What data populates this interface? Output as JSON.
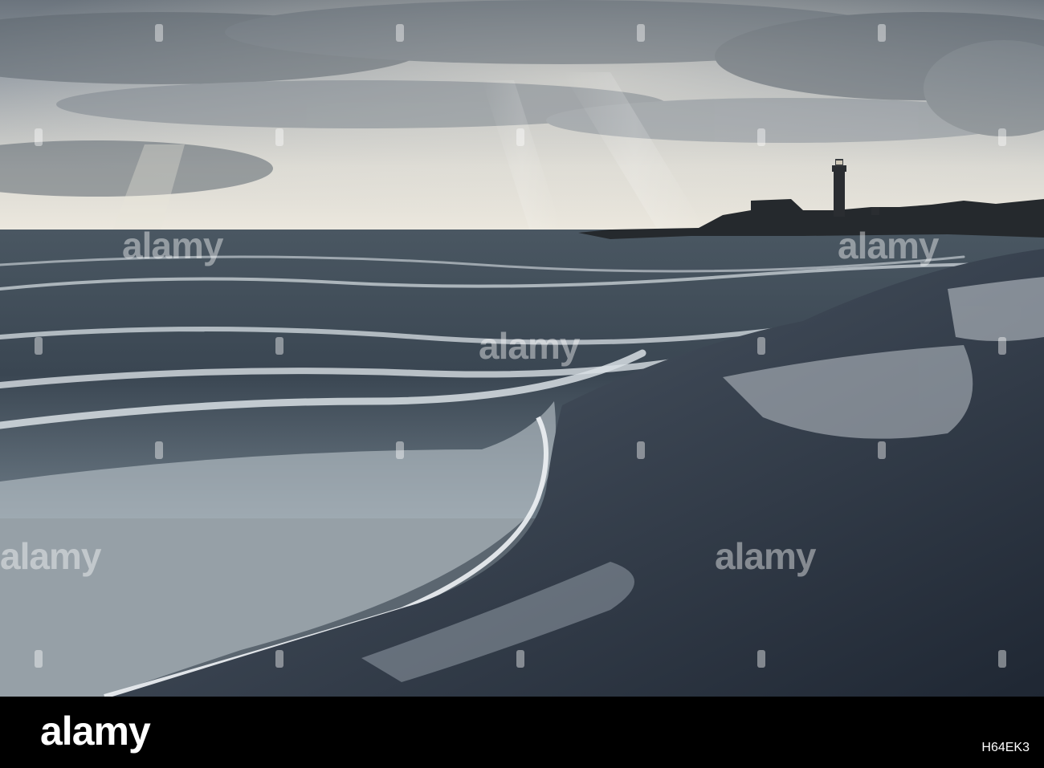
{
  "watermark": {
    "brand_text": "alamy"
  },
  "footer": {
    "logo_text": "alamy",
    "image_id_label": "",
    "image_id": "H64EK3",
    "background_color": "#000000",
    "text_color": "#ffffff"
  },
  "photo": {
    "scene": "stormy-beach-with-lighthouse",
    "colors": {
      "sky_top": "#6e7780",
      "sky_horizon": "#e6e2d8",
      "sea": "#3f4c57",
      "sand": "#2a3340",
      "foam": "#e9eef2"
    }
  }
}
